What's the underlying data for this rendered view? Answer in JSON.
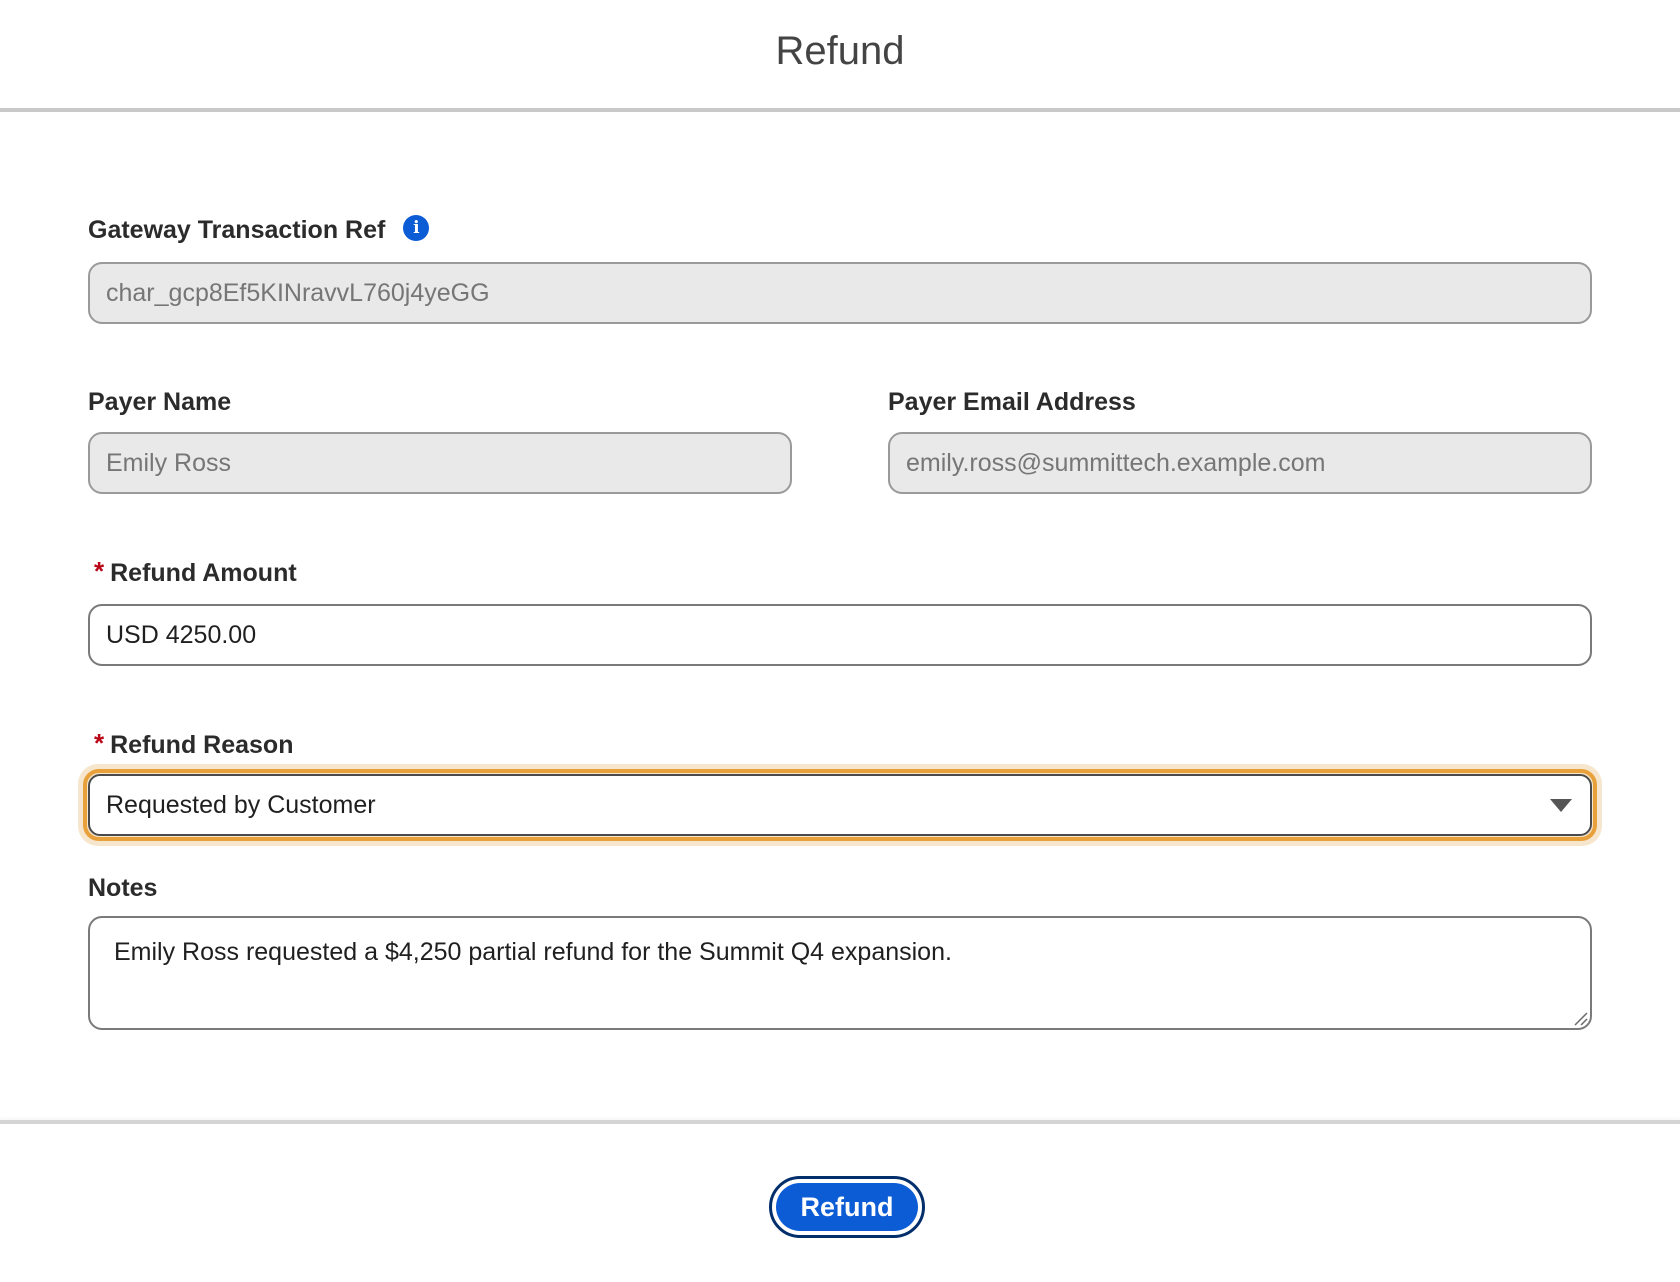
{
  "modal": {
    "title": "Refund"
  },
  "form": {
    "gateway_ref": {
      "label": "Gateway Transaction Ref",
      "value": "char_gcp8Ef5KINravvL760j4yeGG",
      "info_icon": "info-icon"
    },
    "payer_name": {
      "label": "Payer Name",
      "value": "Emily Ross"
    },
    "payer_email": {
      "label": "Payer Email Address",
      "value": "emily.ross@summittech.example.com"
    },
    "refund_amount": {
      "required_marker": "*",
      "label": "Refund Amount",
      "value": "USD 4250.00"
    },
    "refund_reason": {
      "required_marker": "*",
      "label": "Refund Reason",
      "selected": "Requested by Customer",
      "icon": "chevron-down-icon"
    },
    "notes": {
      "label": "Notes",
      "value": "Emily Ross requested a $4,250 partial refund for the Summit Q4 expansion."
    }
  },
  "footer": {
    "submit_label": "Refund"
  },
  "colors": {
    "brand_blue": "#0b5cd5",
    "focus_orange": "#e8a13a",
    "required_red": "#ba0517"
  }
}
